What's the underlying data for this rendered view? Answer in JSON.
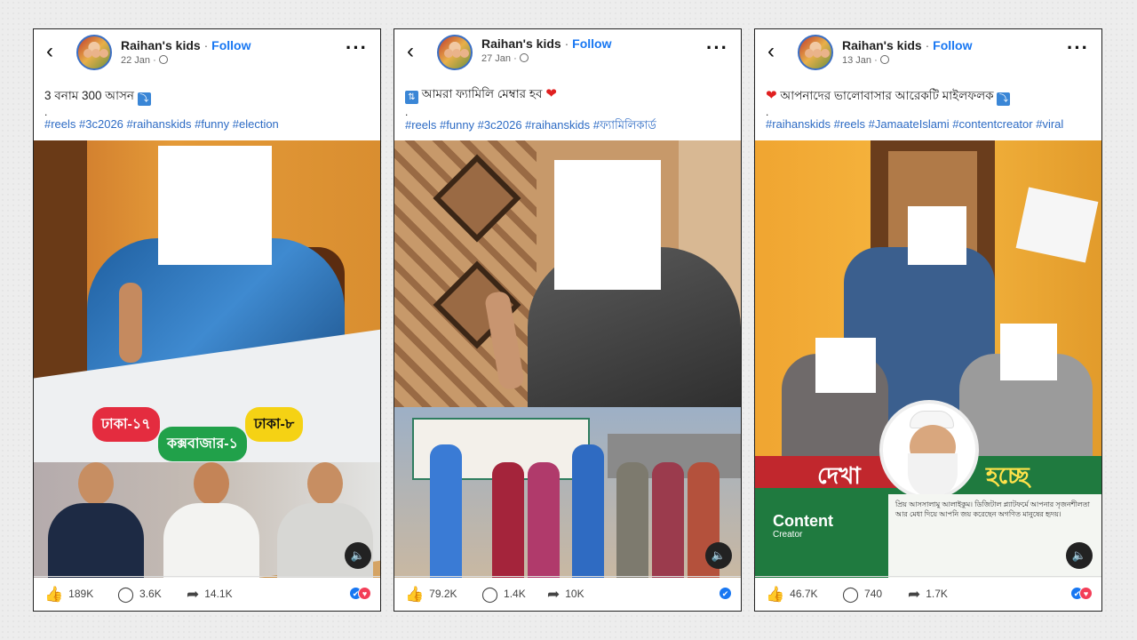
{
  "posts": [
    {
      "author": "Raihan's kids",
      "follow": "Follow",
      "date": "22 Jan",
      "caption": "3 বনাম 300 আসন",
      "caption_badge": "⤵",
      "dot": ".",
      "tags": "#reels #3c2026 #raihanskids #funny #election",
      "labels": {
        "red": "ঢাকা-১৭",
        "green": "কক্সবাজার-১",
        "yellow": "ঢাকা-৮"
      },
      "likes": "189K",
      "comments": "3.6K",
      "shares": "14.1K"
    },
    {
      "author": "Raihan's kids",
      "follow": "Follow",
      "date": "27 Jan",
      "caption_badge": "⇅",
      "caption": "আমরা ফ্যামিলি মেম্বার হব",
      "dot": ".",
      "tags": "#reels #funny #3c2026 #raihanskids #ফ্যামিলিকার্ড",
      "likes": "79.2K",
      "comments": "1.4K",
      "shares": "10K"
    },
    {
      "author": "Raihan's kids",
      "follow": "Follow",
      "date": "13 Jan",
      "caption": "আপনাদের ভালোবাসার আরেকটি মাইলফলক",
      "caption_badge": "⤵",
      "dot": ".",
      "tags": "#raihanskids #reels #JamaateIslami #contentcreator #viral",
      "banner": {
        "left": "দেখা",
        "right": "হচ্ছে"
      },
      "logo": {
        "line1": "Content",
        "line2": "Creator"
      },
      "letter": "প্রিয় আসসালামু আলাইকুম। ডিজিটাল প্ল্যাটফর্মে আপনার সৃজনশীলতা আর মেধা দিয়ে আপনি জয় করেছেন অগণিত মানুষের হৃদয়।",
      "likes": "46.7K",
      "comments": "740",
      "shares": "1.7K"
    }
  ],
  "icons": {
    "back": "back-arrow-icon",
    "more": "more-options-icon",
    "globe": "globe-icon",
    "like": "like-icon",
    "comment": "comment-icon",
    "share": "share-icon",
    "sound": "speaker-icon"
  },
  "colors": {
    "accent": "#1877f2",
    "hashtag": "#2d6bc4",
    "love": "#f33e58"
  }
}
